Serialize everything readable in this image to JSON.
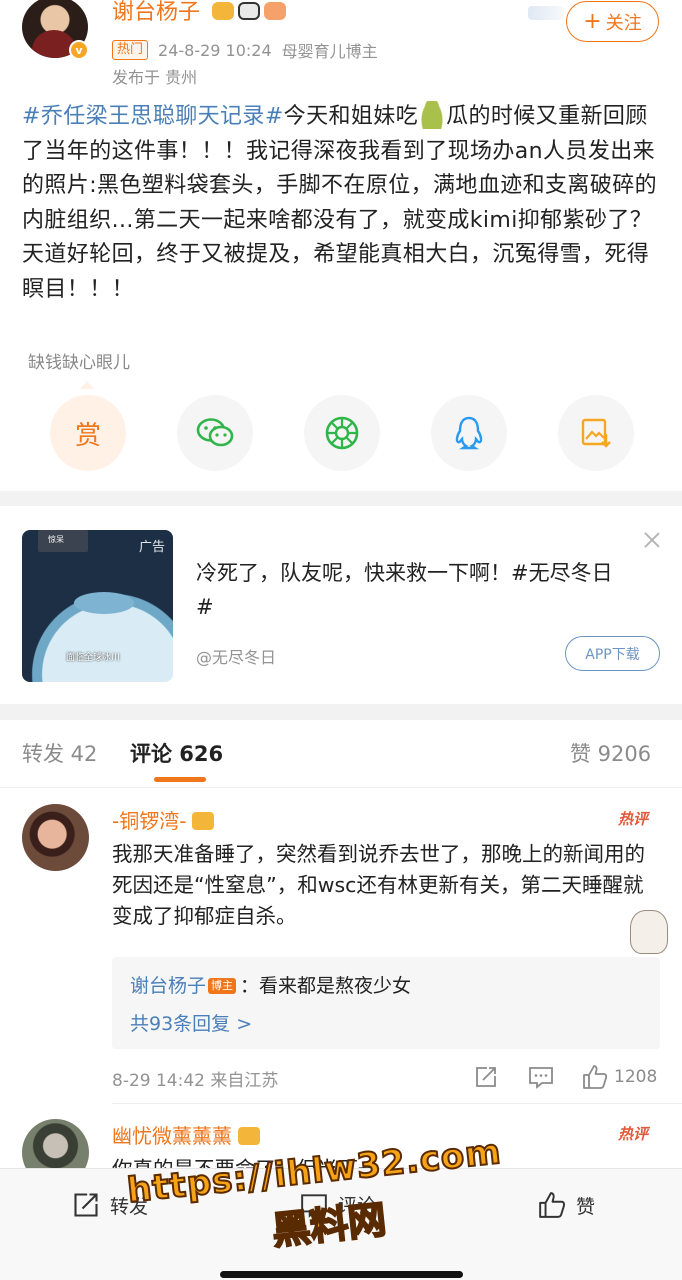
{
  "post": {
    "author": "谢台杨子",
    "tag_hot": "热门",
    "timestamp": "24-8-29 10:24",
    "author_title": "母婴育儿博主",
    "location": "发布于 贵州",
    "follow_label": "关注",
    "follow_plus": "+",
    "verified_badge": "v",
    "body": {
      "hashtag": "#乔任梁王思聪聊天记录#",
      "part1": "今天和姐妹吃",
      "part2": "瓜的时候又重新回顾了当年的这件事！！！我记得深夜我看到了现场办an人员发出来的照片:黑色塑料袋套头，手脚不在原位，满地血迹和支离破碎的内脏组织...第二天一起来啥都没有了，就变成kimi抑郁紫砂了？天道好轮回，终于又被提及，希望能真相大白，沉冤得雪，死得瞑目！！！"
    },
    "tip_label": "缺钱缺心眼儿",
    "reward_label": "赏"
  },
  "share_icons": [
    "reward-icon",
    "wechat-icon",
    "moments-icon",
    "qq-icon",
    "save-image-icon"
  ],
  "ad": {
    "text": "冷死了，队友呢，快来救一下啊！#无尽冬日#",
    "source": "@无尽冬日",
    "badge": "广告",
    "download_label": "APP下载",
    "thumb_caption": "面临全球冰川",
    "thumb_mini_label": "惊呆"
  },
  "tabs": {
    "repost": "转发 42",
    "comments": "评论 626",
    "likes": "赞 9206"
  },
  "comments": [
    {
      "name": "-铜锣湾-",
      "hot": "热评",
      "text": "我那天准备睡了，突然看到说乔去世了，那晚上的新闻用的死因还是“性窒息”，和wsc还有林更新有关，第二天睡醒就变成了抑郁症自杀。",
      "reply_author": "谢台杨子",
      "reply_badge": "博主",
      "reply_text": "：看来都是熬夜少女",
      "reply_more": "共93条回复 >",
      "meta": "8-29 14:42  来自江苏",
      "likes": "1208"
    },
    {
      "name": "幽忧微薰薰薰",
      "hot": "热评",
      "text": "你真的是不要命了，但当下一"
    }
  ],
  "bottom_bar": {
    "repost": "转发",
    "comment": "评论",
    "like": "赞"
  },
  "watermark": {
    "url": "https://ihlw32.com",
    "name": "黑料网"
  },
  "colors": {
    "accent": "#f0761b",
    "link": "#4a7fb8",
    "muted": "#939393"
  }
}
